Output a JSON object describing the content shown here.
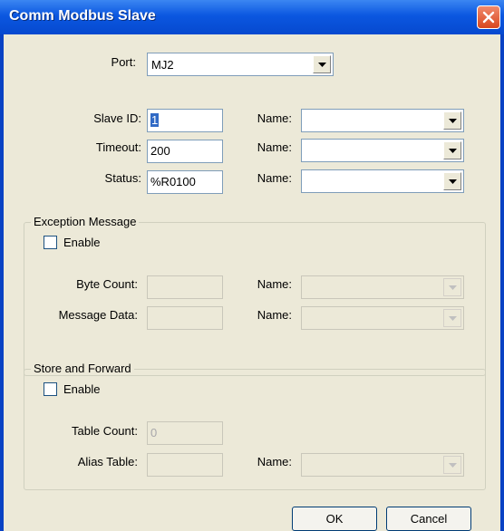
{
  "window": {
    "title": "Comm Modbus Slave"
  },
  "port": {
    "label": "Port:",
    "value": "MJ2"
  },
  "slave_id": {
    "label": "Slave ID:",
    "value": "1",
    "name_label": "Name:",
    "name_value": ""
  },
  "timeout": {
    "label": "Timeout:",
    "value": "200",
    "name_label": "Name:",
    "name_value": ""
  },
  "status": {
    "label": "Status:",
    "value": "%R0100",
    "name_label": "Name:",
    "name_value": ""
  },
  "exception": {
    "title": "Exception Message",
    "enable_label": "Enable",
    "byte_count_label": "Byte Count:",
    "message_data_label": "Message Data:",
    "name_label": "Name:"
  },
  "store_forward": {
    "title": "Store and Forward",
    "enable_label": "Enable",
    "table_count_label": "Table Count:",
    "table_count_value": "0",
    "alias_table_label": "Alias Table:",
    "name_label": "Name:"
  },
  "buttons": {
    "ok": "OK",
    "cancel": "Cancel"
  }
}
